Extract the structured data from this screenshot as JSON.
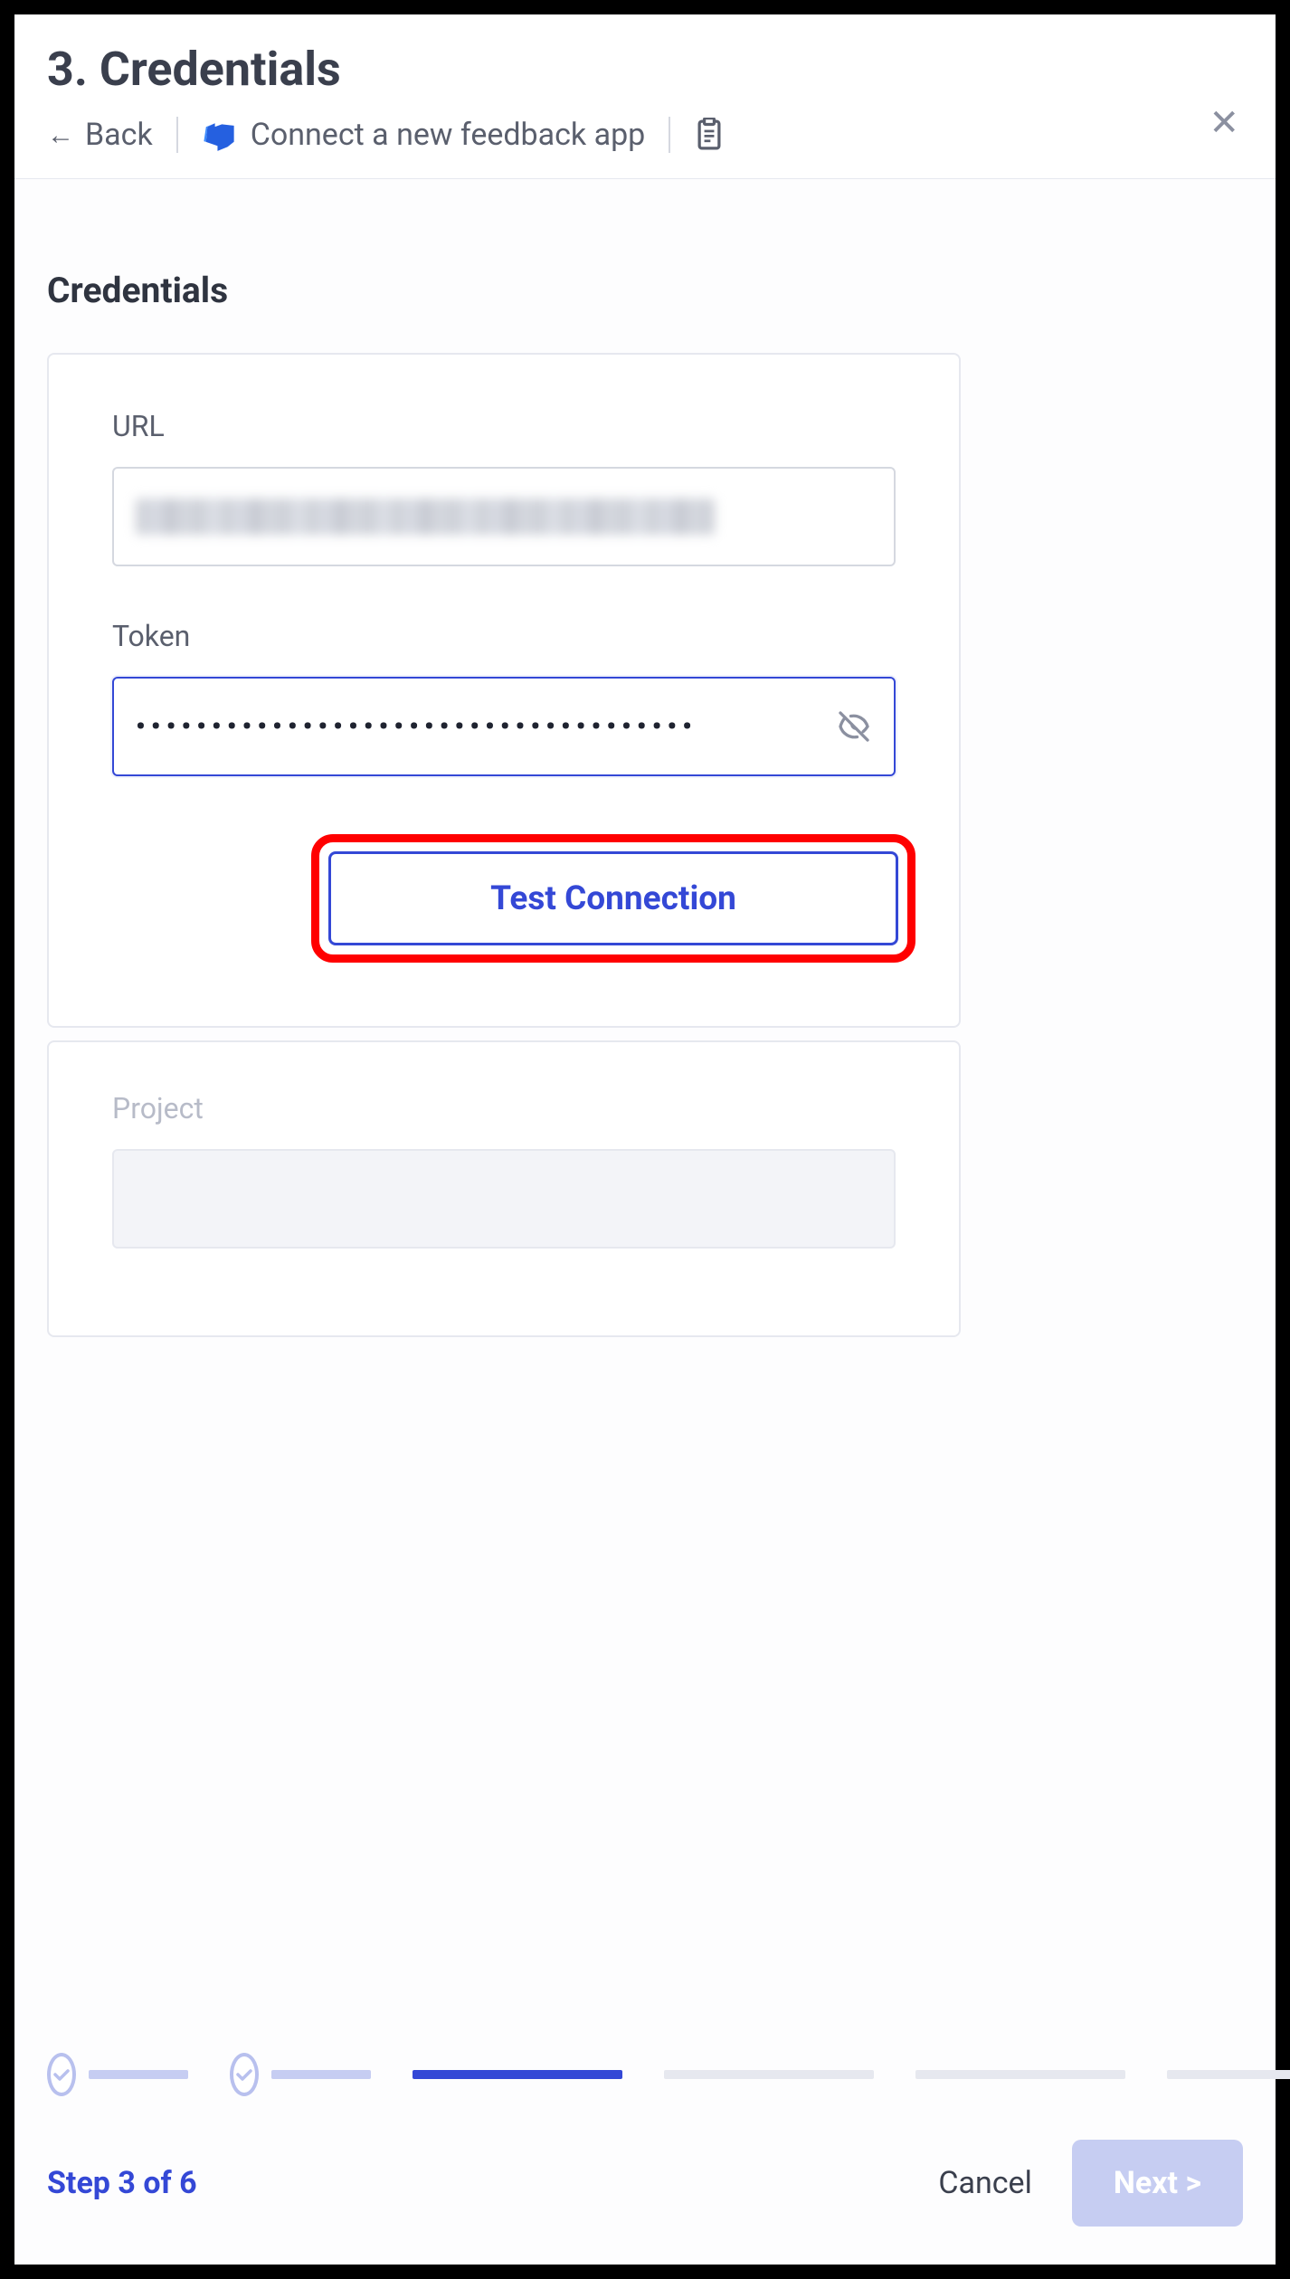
{
  "header": {
    "title": "3. Credentials",
    "back_label": "Back",
    "breadcrumb_label": "Connect a new feedback app"
  },
  "section": {
    "heading": "Credentials"
  },
  "form": {
    "url": {
      "label": "URL",
      "value_redacted": true
    },
    "token": {
      "label": "Token",
      "value_masked": "•••••••••••••••••••••••••••••••••••••"
    },
    "test_button_label": "Test Connection",
    "project": {
      "label": "Project",
      "disabled": true
    }
  },
  "footer": {
    "step_text": "Step 3 of 6",
    "cancel_label": "Cancel",
    "next_label": "Next >",
    "next_disabled": true,
    "current_step": 3,
    "total_steps": 6
  },
  "colors": {
    "accent": "#3448d6",
    "accent_light": "#c6cdf2",
    "highlight_red": "#ff0000"
  }
}
